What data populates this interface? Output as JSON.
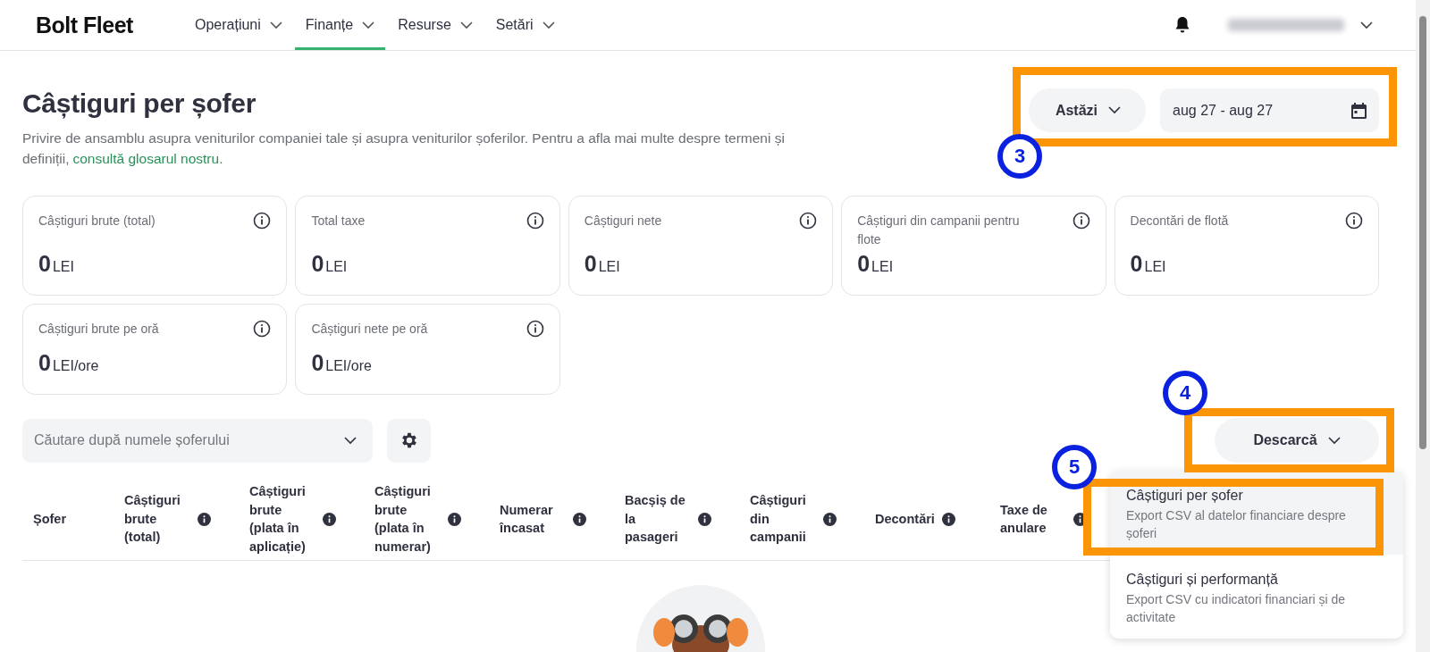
{
  "header": {
    "logo": "Bolt Fleet",
    "nav": [
      {
        "label": "Operațiuni",
        "selected": false
      },
      {
        "label": "Finanțe",
        "selected": true
      },
      {
        "label": "Resurse",
        "selected": false
      },
      {
        "label": "Setări",
        "selected": false
      }
    ]
  },
  "page": {
    "title": "Câștiguri per șofer",
    "description": "Privire de ansamblu asupra veniturilor companiei tale și asupra veniturilor șoferilor. Pentru a afla mai multe despre termeni și definiții,",
    "description_link": "consultă glosarul nostru."
  },
  "period": {
    "preset": "Astăzi",
    "date_range": "aug 27 - aug 27"
  },
  "summary_cards": [
    {
      "label": "Câștiguri brute (total)",
      "value": "0",
      "unit": "LEI"
    },
    {
      "label": "Total taxe",
      "value": "0",
      "unit": "LEI"
    },
    {
      "label": "Câștiguri nete",
      "value": "0",
      "unit": "LEI"
    },
    {
      "label": "Câștiguri din campanii pentru flote",
      "value": "0",
      "unit": "LEI"
    },
    {
      "label": "Decontări de flotă",
      "value": "0",
      "unit": "LEI"
    },
    {
      "label": "Câștiguri brute pe oră",
      "value": "0",
      "unit": "LEI/ore"
    },
    {
      "label": "Câștiguri nete pe oră",
      "value": "0",
      "unit": "LEI/ore"
    }
  ],
  "search": {
    "placeholder": "Căutare după numele șoferului"
  },
  "download": {
    "label": "Descarcă",
    "menu": [
      {
        "title": "Câștiguri per șofer",
        "description": "Export CSV al datelor financiare despre șoferi",
        "selected": true
      },
      {
        "title": "Câștiguri și performanță",
        "description": "Export CSV cu indicatori financiari și de activitate",
        "selected": false
      }
    ]
  },
  "table": {
    "columns": [
      {
        "label": "Șofer",
        "info": false
      },
      {
        "label": "Câștiguri brute (total)",
        "info": true
      },
      {
        "label": "Câștiguri brute (plata în aplicație)",
        "info": true
      },
      {
        "label": "Câștiguri brute (plata în numerar)",
        "info": true
      },
      {
        "label": "Numerar încasat",
        "info": true
      },
      {
        "label": "Bacșiș de la pasageri",
        "info": true
      },
      {
        "label": "Câștiguri din campanii",
        "info": true
      },
      {
        "label": "Decontări",
        "info": true
      },
      {
        "label": "Taxe de anulare",
        "info": true
      }
    ]
  },
  "annotations": [
    {
      "number": "3"
    },
    {
      "number": "4"
    },
    {
      "number": "5"
    }
  ]
}
